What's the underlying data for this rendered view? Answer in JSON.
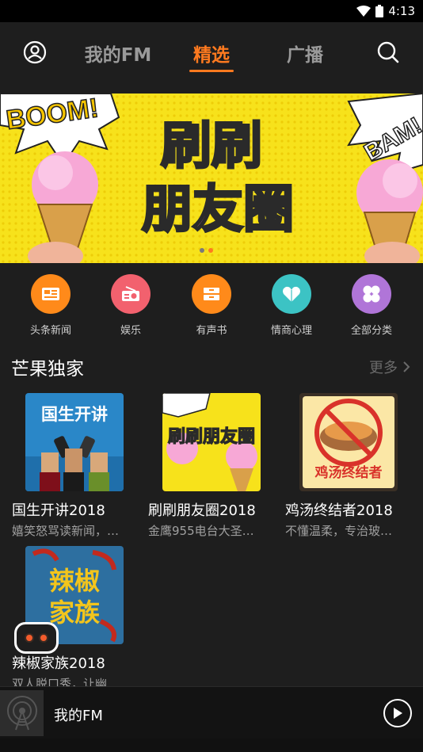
{
  "status_bar": {
    "time": "4:13"
  },
  "nav": {
    "tabs": [
      {
        "label": "我的FM"
      },
      {
        "label": "精选"
      },
      {
        "label": "广播"
      }
    ],
    "active_tab": "精选"
  },
  "banner": {
    "title_line1": "刷刷",
    "title_line2": "朋友圈",
    "boom_text": "BOOM!",
    "bam_text": "BAM!"
  },
  "categories": [
    {
      "label": "头条新闻",
      "color": "#ff8a1a",
      "icon": "news-icon"
    },
    {
      "label": "娱乐",
      "color": "#f2616e",
      "icon": "radio-icon"
    },
    {
      "label": "有声书",
      "color": "#ff8a1a",
      "icon": "audiobook-icon"
    },
    {
      "label": "情商心理",
      "color": "#3cc3c4",
      "icon": "heart-icon"
    },
    {
      "label": "全部分类",
      "color": "#b075d8",
      "icon": "clover-icon"
    }
  ],
  "section": {
    "title": "芒果独家",
    "more": "更多"
  },
  "albums": [
    {
      "title": "国生开讲2018",
      "subtitle": "嬉笑怒骂读新闻，…",
      "cover_text": "国生开讲"
    },
    {
      "title": "刷刷朋友圈2018",
      "subtitle": "金鹰955电台大圣…",
      "cover_text": "刷刷朋友圈"
    },
    {
      "title": "鸡汤终结者2018",
      "subtitle": "不懂温柔，专治玻…",
      "cover_text": "鸡汤终结者"
    },
    {
      "title": "辣椒家族2018",
      "subtitle": "双人脱口秀，让幽…",
      "cover_text_1": "辣椒",
      "cover_text_2": "家族"
    }
  ],
  "player": {
    "title": "我的FM"
  }
}
